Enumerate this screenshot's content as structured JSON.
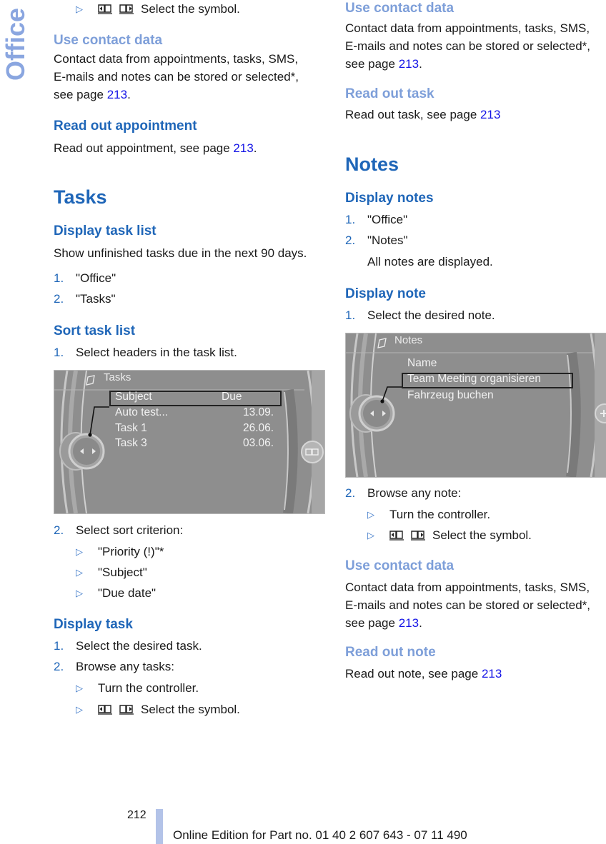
{
  "side_tab": "Office",
  "left": {
    "top_bullet": "Select the symbol.",
    "contact": {
      "heading": "Use contact data",
      "line1": "Contact data from appointments, tasks, SMS,",
      "line2": "E-mails and notes can be stored or selected*,",
      "line3_prefix": "see page ",
      "page": "213",
      "suffix": "."
    },
    "read_appt": {
      "heading": "Read out appointment",
      "prefix": "Read out appointment, see page ",
      "page": "213",
      "suffix": "."
    },
    "tasks_title": "Tasks",
    "display_list": {
      "heading": "Display task list",
      "text": "Show unfinished tasks due in the next 90 days.",
      "steps": [
        {
          "num": "1.",
          "text": "\"Office\""
        },
        {
          "num": "2.",
          "text": "\"Tasks\""
        }
      ]
    },
    "sort_list": {
      "heading": "Sort task list",
      "step1": {
        "num": "1.",
        "text": "Select headers in the task list."
      },
      "step2": {
        "num": "2.",
        "text": "Select sort criterion:"
      },
      "criteria": [
        "\"Priority (!)\"*",
        "\"Subject\"",
        "\"Due date\""
      ]
    },
    "tasks_screen": {
      "title": "Tasks",
      "header_subject": "Subject",
      "header_due": "Due",
      "rows": [
        {
          "subject": "Auto test...",
          "due": "13.09."
        },
        {
          "subject": "Task 1",
          "due": "26.06."
        },
        {
          "subject": "Task 3",
          "due": "03.06."
        }
      ]
    },
    "display_task": {
      "heading": "Display task",
      "steps": [
        {
          "num": "1.",
          "text": "Select the desired task."
        },
        {
          "num": "2.",
          "text": "Browse any tasks:"
        }
      ],
      "bullets": [
        "Turn the controller.",
        "Select the symbol."
      ]
    }
  },
  "right": {
    "contact": {
      "heading": "Use contact data",
      "line1": "Contact data from appointments, tasks, SMS,",
      "line2": "E-mails and notes can be stored or selected*,",
      "line3_prefix": "see page ",
      "page": "213",
      "suffix": "."
    },
    "read_task": {
      "heading": "Read out task",
      "prefix": "Read out task, see page ",
      "page": "213"
    },
    "notes_title": "Notes",
    "display_notes": {
      "heading": "Display notes",
      "steps": [
        {
          "num": "1.",
          "text": "\"Office\""
        },
        {
          "num": "2.",
          "text": "\"Notes\""
        }
      ],
      "result": "All notes are displayed."
    },
    "display_note": {
      "heading": "Display note",
      "step1": {
        "num": "1.",
        "text": "Select the desired note."
      },
      "step2": {
        "num": "2.",
        "text": "Browse any note:"
      },
      "bullets": [
        "Turn the controller.",
        "Select the symbol."
      ]
    },
    "notes_screen": {
      "title": "Notes",
      "rows": [
        "Name",
        "Team Meeting organisieren",
        "Fahrzeug buchen"
      ]
    },
    "contact2": {
      "heading": "Use contact data",
      "line1": "Contact data from appointments, tasks, SMS,",
      "line2": "E-mails and notes can be stored or selected*,",
      "line3_prefix": "see page ",
      "page": "213",
      "suffix": "."
    },
    "read_note": {
      "heading": "Read out note",
      "prefix": "Read out note, see page ",
      "page": "213"
    }
  },
  "footer": {
    "page_number": "212",
    "edition": "Online Edition for Part no. 01 40 2 607 643 - 07 11 490"
  }
}
